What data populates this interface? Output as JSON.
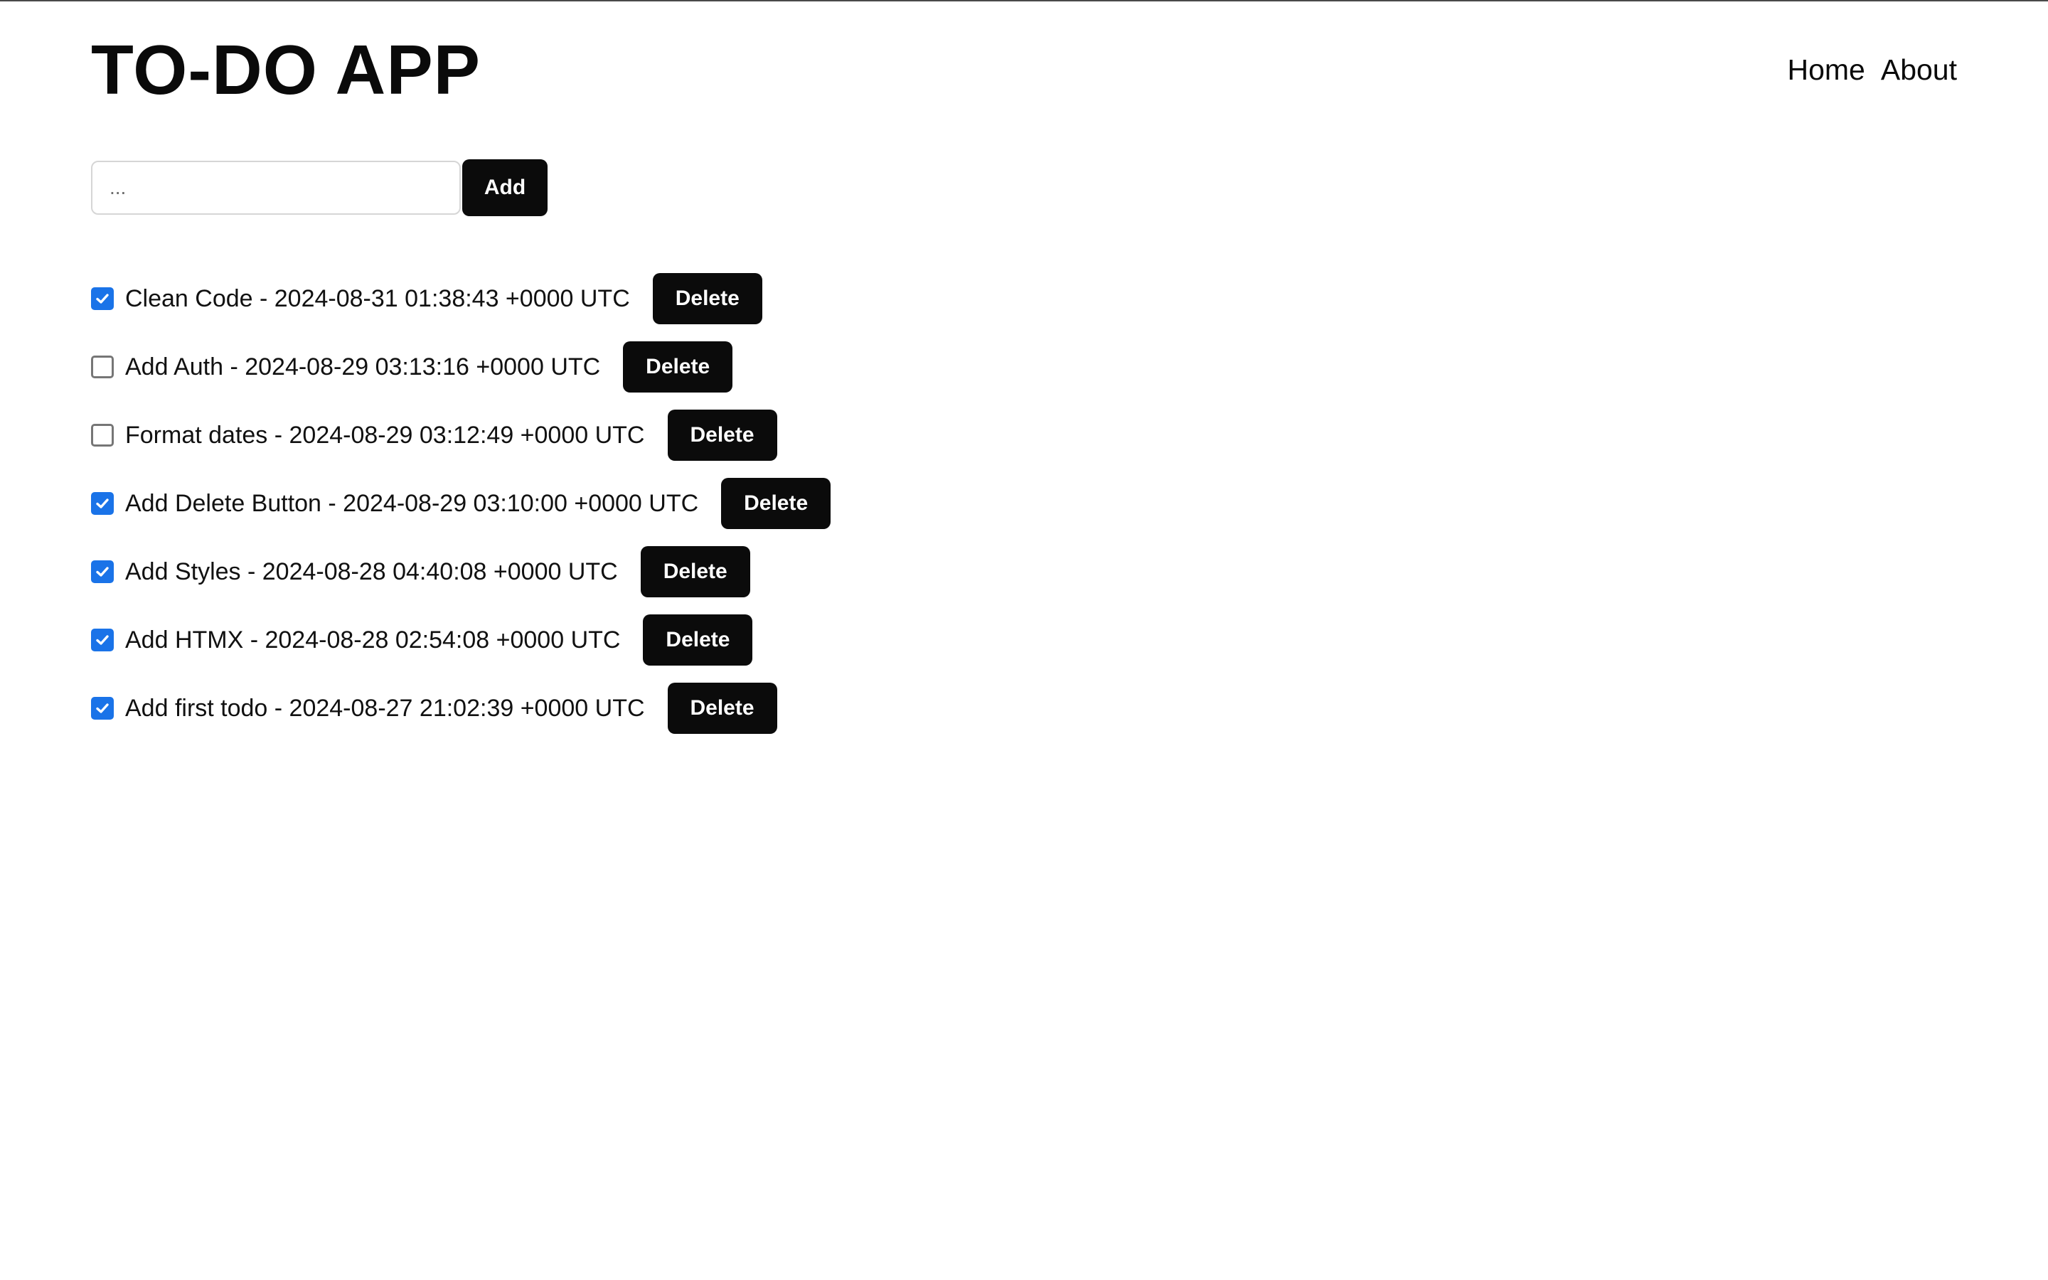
{
  "header": {
    "title": "TO-DO APP",
    "nav": [
      {
        "label": "Home"
      },
      {
        "label": "About"
      }
    ]
  },
  "add_form": {
    "placeholder": "...",
    "value": "",
    "add_label": "Add"
  },
  "todos": [
    {
      "title": "Clean Code",
      "created": "2024-08-31 01:38:43 +0000 UTC",
      "text": "Clean Code - 2024-08-31 01:38:43 +0000 UTC",
      "done": true,
      "delete_label": "Delete"
    },
    {
      "title": "Add Auth",
      "created": "2024-08-29 03:13:16 +0000 UTC",
      "text": "Add Auth - 2024-08-29 03:13:16 +0000 UTC",
      "done": false,
      "delete_label": "Delete"
    },
    {
      "title": "Format dates",
      "created": "2024-08-29 03:12:49 +0000 UTC",
      "text": "Format dates - 2024-08-29 03:12:49 +0000 UTC",
      "done": false,
      "delete_label": "Delete"
    },
    {
      "title": "Add Delete Button",
      "created": "2024-08-29 03:10:00 +0000 UTC",
      "text": "Add Delete Button - 2024-08-29 03:10:00 +0000 UTC",
      "done": true,
      "delete_label": "Delete"
    },
    {
      "title": "Add Styles",
      "created": "2024-08-28 04:40:08 +0000 UTC",
      "text": "Add Styles - 2024-08-28 04:40:08 +0000 UTC",
      "done": true,
      "delete_label": "Delete"
    },
    {
      "title": "Add HTMX",
      "created": "2024-08-28 02:54:08 +0000 UTC",
      "text": "Add HTMX - 2024-08-28 02:54:08 +0000 UTC",
      "done": true,
      "delete_label": "Delete"
    },
    {
      "title": "Add first todo",
      "created": "2024-08-27 21:02:39 +0000 UTC",
      "text": "Add first todo - 2024-08-27 21:02:39 +0000 UTC",
      "done": true,
      "delete_label": "Delete"
    }
  ],
  "colors": {
    "checkbox_checked": "#1a73e8",
    "button_bg": "#0b0b0b",
    "button_text": "#ffffff"
  }
}
